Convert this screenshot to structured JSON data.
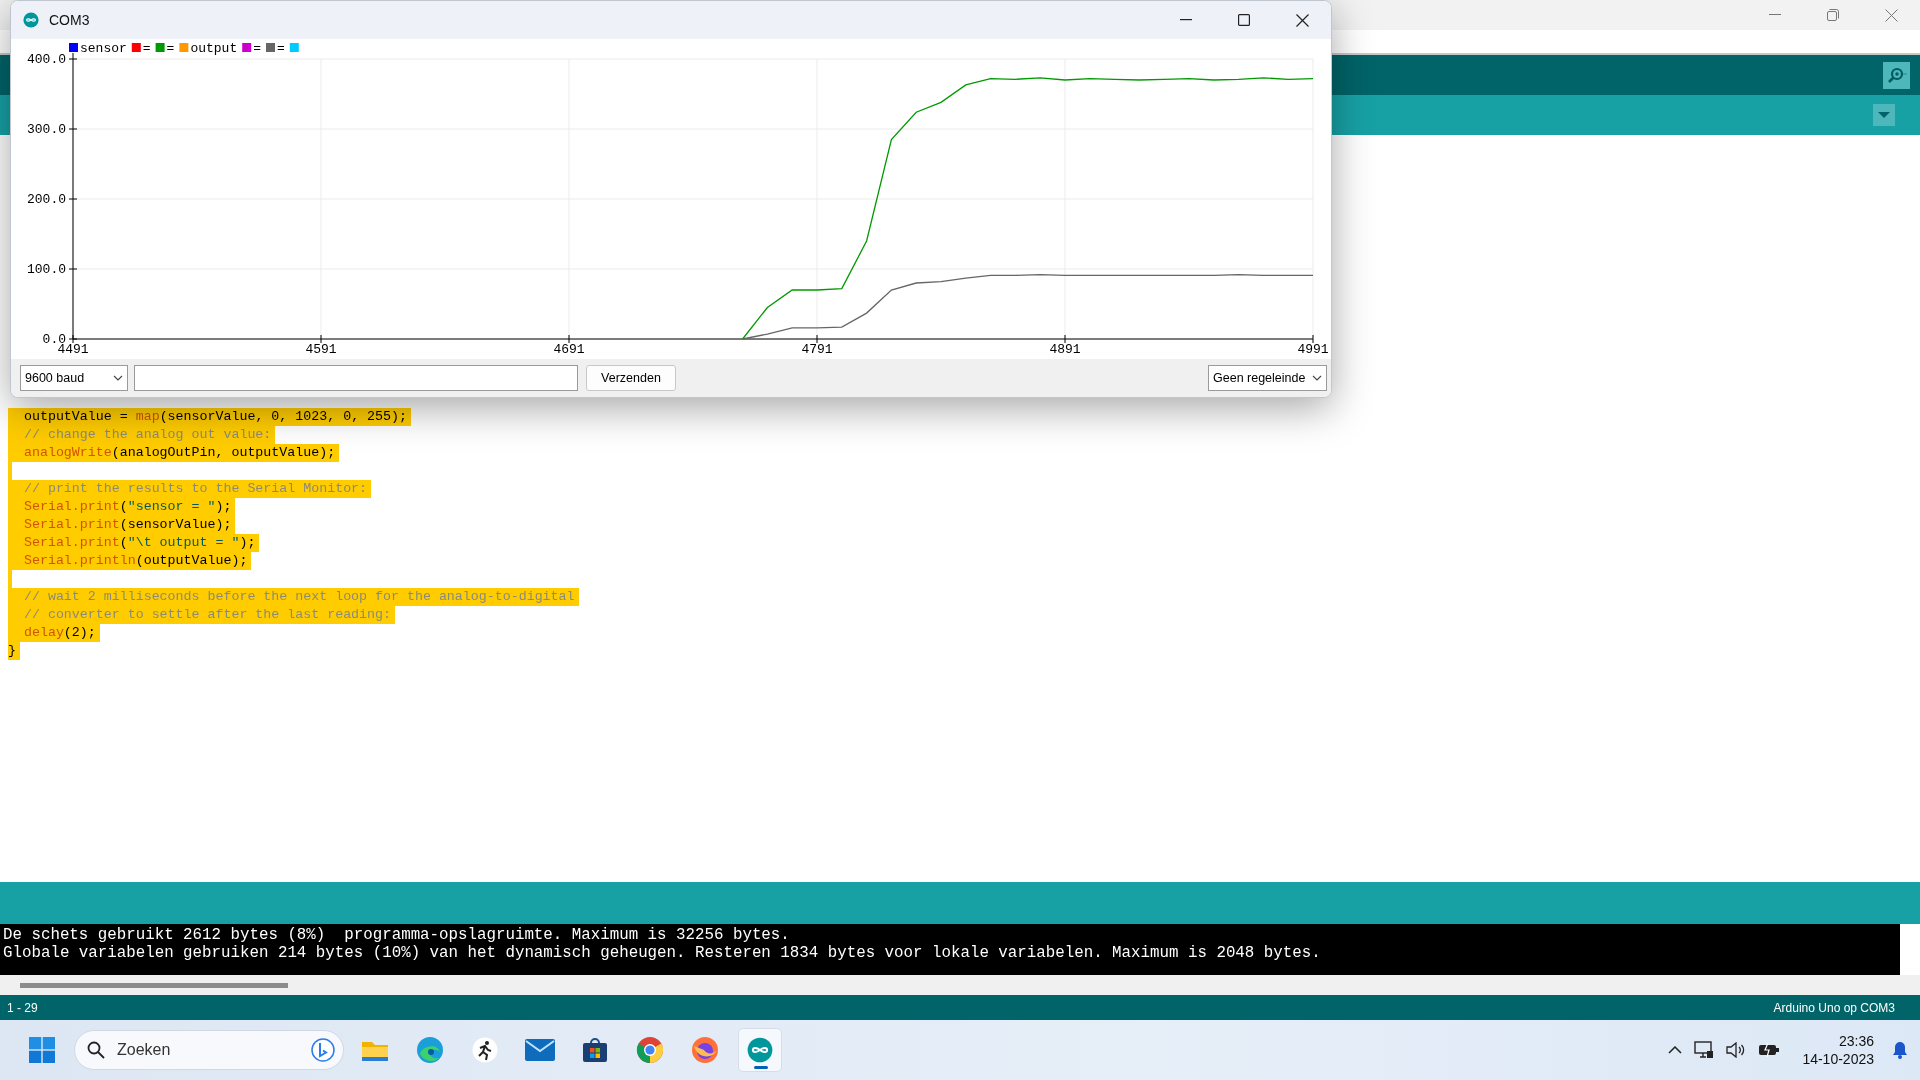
{
  "plotter": {
    "title": "COM3",
    "legend": [
      {
        "label": "sensor",
        "color": "#0000ff"
      },
      {
        "label": "=",
        "color": "#ff0000"
      },
      {
        "kind": "series"
      },
      {
        "label": "output",
        "color": "#ff9900"
      },
      {
        "label": "=",
        "color": "#cc00cc"
      },
      {
        "kind": "series"
      },
      {
        "color": "#00ccff"
      }
    ],
    "chart_data": {
      "type": "line",
      "grid": true,
      "x": [
        4761,
        4771,
        4781,
        4791,
        4801,
        4811,
        4821,
        4831,
        4841,
        4851,
        4861,
        4871,
        4881,
        4891,
        4901,
        4911,
        4921,
        4931,
        4941,
        4951,
        4961,
        4971,
        4981,
        4991
      ],
      "series": [
        {
          "name": "=",
          "color": "#009900",
          "values": [
            0,
            45,
            70,
            70,
            72,
            140,
            285,
            324,
            338,
            363,
            372,
            371,
            373,
            370,
            372,
            371,
            370,
            371,
            372,
            370,
            371,
            373,
            371,
            372
          ]
        },
        {
          "name": "=",
          "color": "#666666",
          "values": [
            0,
            7,
            16,
            16,
            17,
            37,
            70,
            80,
            82,
            87,
            91,
            91,
            92,
            91,
            91,
            91,
            91,
            91,
            91,
            91,
            92,
            91,
            91,
            91
          ]
        }
      ],
      "xlim": [
        4491,
        4991
      ],
      "ylim": [
        0,
        400
      ],
      "xticks": [
        4491,
        4591,
        4691,
        4791,
        4891,
        4991
      ],
      "yticks": [
        {
          "value": 0,
          "label": "0.0"
        },
        {
          "value": 100,
          "label": "100.0"
        },
        {
          "value": 200,
          "label": "200.0"
        },
        {
          "value": 300,
          "label": "300.0"
        },
        {
          "value": 400,
          "label": "400.0"
        }
      ]
    },
    "baud": "9600 baud",
    "send_button": "Verzenden",
    "line_ending": "Geen regeleinde"
  },
  "editor": {
    "lines": [
      {
        "kind": "code",
        "tokens": [
          {
            "kind": "plain",
            "text": "  outputValue = "
          },
          {
            "kind": "fn",
            "text": "map"
          },
          {
            "kind": "plain",
            "text": "(sensorValue, 0, 1023, 0, 255);"
          }
        ]
      },
      {
        "kind": "code",
        "tokens": [
          {
            "kind": "comment",
            "text": "  // change the analog out value:"
          }
        ]
      },
      {
        "kind": "code",
        "tokens": [
          {
            "kind": "fn",
            "text": "  analogWrite"
          },
          {
            "kind": "plain",
            "text": "(analogOutPin, outputValue);"
          }
        ]
      },
      {
        "kind": "blank"
      },
      {
        "kind": "code",
        "tokens": [
          {
            "kind": "comment",
            "text": "  // print the results to the Serial Monitor:"
          }
        ]
      },
      {
        "kind": "code",
        "tokens": [
          {
            "kind": "fn",
            "text": "  Serial.print"
          },
          {
            "kind": "plain",
            "text": "("
          },
          {
            "kind": "string",
            "text": "\"sensor = \""
          },
          {
            "kind": "plain",
            "text": ");"
          }
        ]
      },
      {
        "kind": "code",
        "tokens": [
          {
            "kind": "fn",
            "text": "  Serial.print"
          },
          {
            "kind": "plain",
            "text": "(sensorValue);"
          }
        ]
      },
      {
        "kind": "code",
        "tokens": [
          {
            "kind": "fn",
            "text": "  Serial.print"
          },
          {
            "kind": "plain",
            "text": "("
          },
          {
            "kind": "string",
            "text": "\"\\t output = \""
          },
          {
            "kind": "plain",
            "text": ");"
          }
        ]
      },
      {
        "kind": "code",
        "tokens": [
          {
            "kind": "fn",
            "text": "  Serial.println"
          },
          {
            "kind": "plain",
            "text": "(outputValue);"
          }
        ]
      },
      {
        "kind": "blank"
      },
      {
        "kind": "code",
        "tokens": [
          {
            "kind": "comment",
            "text": "  // wait 2 milliseconds before the next loop for the analog-to-digital"
          }
        ]
      },
      {
        "kind": "code",
        "tokens": [
          {
            "kind": "comment",
            "text": "  // converter to settle after the last reading:"
          }
        ]
      },
      {
        "kind": "code",
        "tokens": [
          {
            "kind": "fn",
            "text": "  delay"
          },
          {
            "kind": "plain",
            "text": "(2);"
          }
        ]
      },
      {
        "kind": "code",
        "tokens": [
          {
            "kind": "plain",
            "text": "}"
          }
        ]
      }
    ]
  },
  "console": {
    "lines": [
      "De schets gebruikt 2612 bytes (8%)  programma-opslagruimte. Maximum is 32256 bytes.",
      "Globale variabelen gebruiken 214 bytes (10%) van het dynamisch geheugen. Resteren 1834 bytes voor lokale variabelen. Maximum is 2048 bytes."
    ]
  },
  "status_bar": {
    "position": "1 - 29",
    "board": "Arduino Uno op COM3"
  },
  "taskbar": {
    "search_placeholder": "Zoeken",
    "apps": [
      {
        "kind": "folder",
        "selected": false
      },
      {
        "kind": "edge",
        "selected": false
      },
      {
        "kind": "runner",
        "selected": false
      },
      {
        "kind": "mail",
        "selected": false
      },
      {
        "kind": "store",
        "selected": false
      },
      {
        "kind": "chrome",
        "selected": false
      },
      {
        "kind": "firefox",
        "selected": false
      },
      {
        "kind": "arduino",
        "selected": true
      }
    ],
    "time": "23:36",
    "date": "14-10-2023"
  }
}
